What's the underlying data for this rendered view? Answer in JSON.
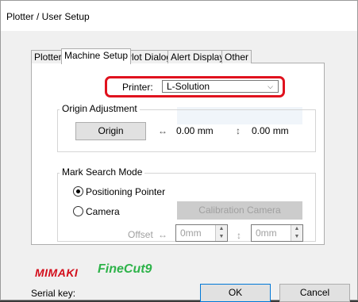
{
  "window": {
    "title": "Plotter / User Setup"
  },
  "tabs": [
    {
      "label": "Plotter"
    },
    {
      "label": "Machine Setup"
    },
    {
      "label": "Plot Dialog"
    },
    {
      "label": "Alert Display"
    },
    {
      "label": "Other"
    }
  ],
  "printer": {
    "label": "Printer:",
    "value": "L-Solution"
  },
  "origin": {
    "group_label": "Origin Adjustment",
    "button": "Origin",
    "x_icon": "↔",
    "x_value": "0.00 mm",
    "y_icon": "↕",
    "y_value": "0.00 mm"
  },
  "mark_search": {
    "group_label": "Mark Search Mode",
    "option_pointer": "Positioning Pointer",
    "option_camera": "Camera",
    "selected": "Positioning Pointer",
    "calibration_button": "Calibration Camera",
    "offset_label": "Offset",
    "offset_x_icon": "↔",
    "offset_x": "0mm",
    "offset_y_icon": "↕",
    "offset_y": "0mm"
  },
  "footer": {
    "logo_left": "MIMAKI",
    "logo_right": "FineCut9",
    "serial_label": "Serial key:",
    "ok": "OK",
    "cancel": "Cancel"
  },
  "colors": {
    "accent": "#0078d7",
    "highlight": "#e0121e",
    "mimaki": "#d30e1b",
    "finecut": "#2eb34a"
  }
}
